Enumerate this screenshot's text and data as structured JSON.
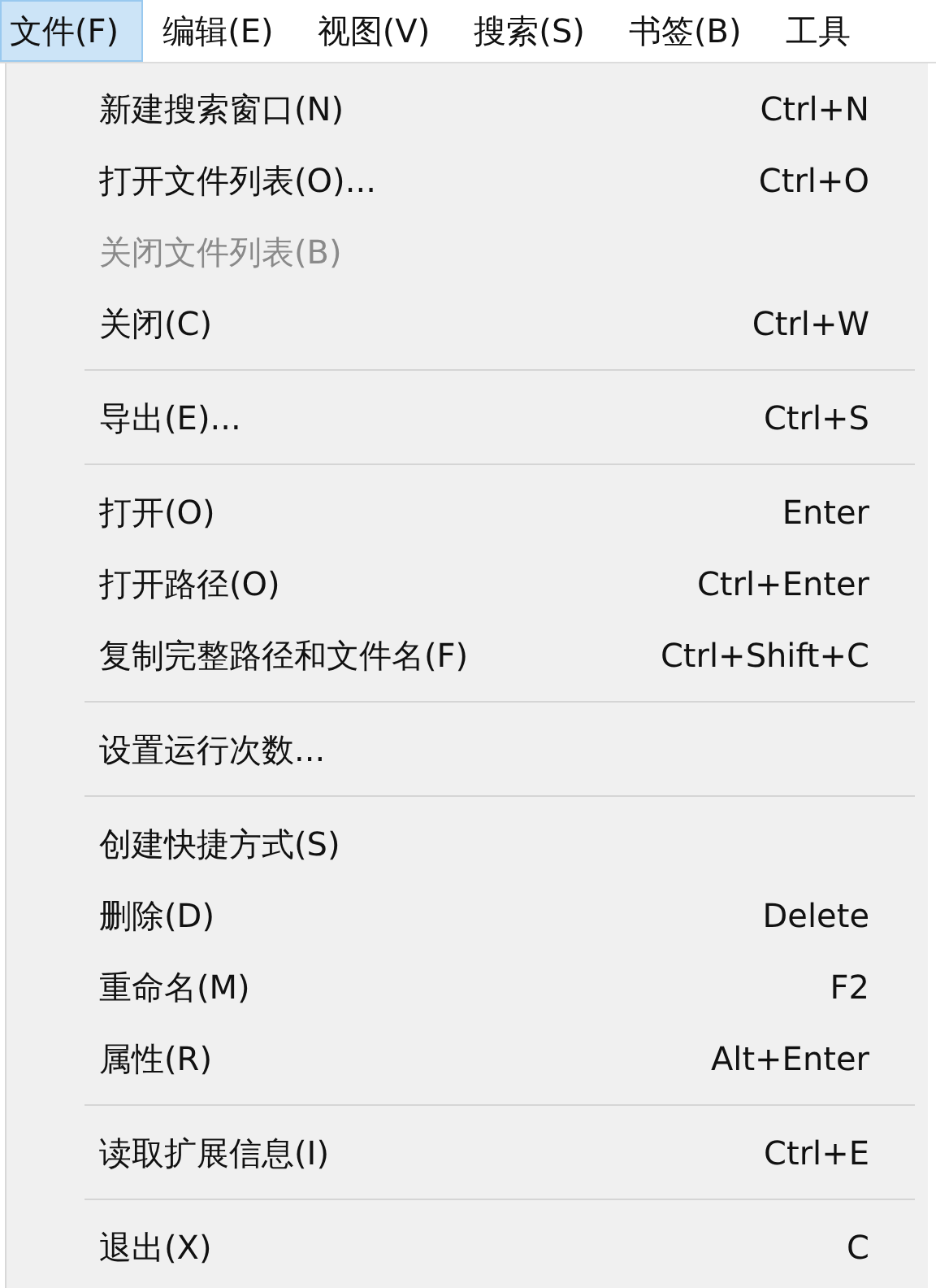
{
  "menu_bar": [
    {
      "label": "文件(F)",
      "selected": true
    },
    {
      "label": "编辑(E)",
      "selected": false
    },
    {
      "label": "视图(V)",
      "selected": false
    },
    {
      "label": "搜索(S)",
      "selected": false
    },
    {
      "label": "书签(B)",
      "selected": false
    },
    {
      "label": "工具",
      "selected": false
    }
  ],
  "menu": [
    {
      "kind": "item",
      "label": "新建搜索窗口(N)",
      "shortcut": "Ctrl+N",
      "disabled": false
    },
    {
      "kind": "item",
      "label": "打开文件列表(O)...",
      "shortcut": "Ctrl+O",
      "disabled": false
    },
    {
      "kind": "item",
      "label": "关闭文件列表(B)",
      "disabled": true
    },
    {
      "kind": "item",
      "label": "关闭(C)",
      "shortcut": "Ctrl+W",
      "disabled": false
    },
    {
      "kind": "separator"
    },
    {
      "kind": "item",
      "label": "导出(E)...",
      "shortcut": "Ctrl+S",
      "disabled": false
    },
    {
      "kind": "separator"
    },
    {
      "kind": "item",
      "label": "打开(O)",
      "shortcut": "Enter",
      "disabled": false
    },
    {
      "kind": "item",
      "label": "打开路径(O)",
      "shortcut": "Ctrl+Enter",
      "disabled": false
    },
    {
      "kind": "item",
      "label": "复制完整路径和文件名(F)",
      "shortcut": "Ctrl+Shift+C",
      "disabled": false
    },
    {
      "kind": "separator"
    },
    {
      "kind": "item",
      "label": "设置运行次数...",
      "disabled": false
    },
    {
      "kind": "separator"
    },
    {
      "kind": "item",
      "label": "创建快捷方式(S)",
      "disabled": false
    },
    {
      "kind": "item",
      "label": "删除(D)",
      "shortcut": "Delete",
      "disabled": false
    },
    {
      "kind": "item",
      "label": "重命名(M)",
      "shortcut": "F2",
      "disabled": false
    },
    {
      "kind": "item",
      "label": "属性(R)",
      "shortcut": "Alt+Enter",
      "disabled": false
    },
    {
      "kind": "separator"
    },
    {
      "kind": "item",
      "label": "读取扩展信息(I)",
      "shortcut": "Ctrl+E",
      "disabled": false
    },
    {
      "kind": "separator"
    },
    {
      "kind": "item",
      "label": "退出(X)",
      "shortcut": "C",
      "disabled": false
    }
  ]
}
